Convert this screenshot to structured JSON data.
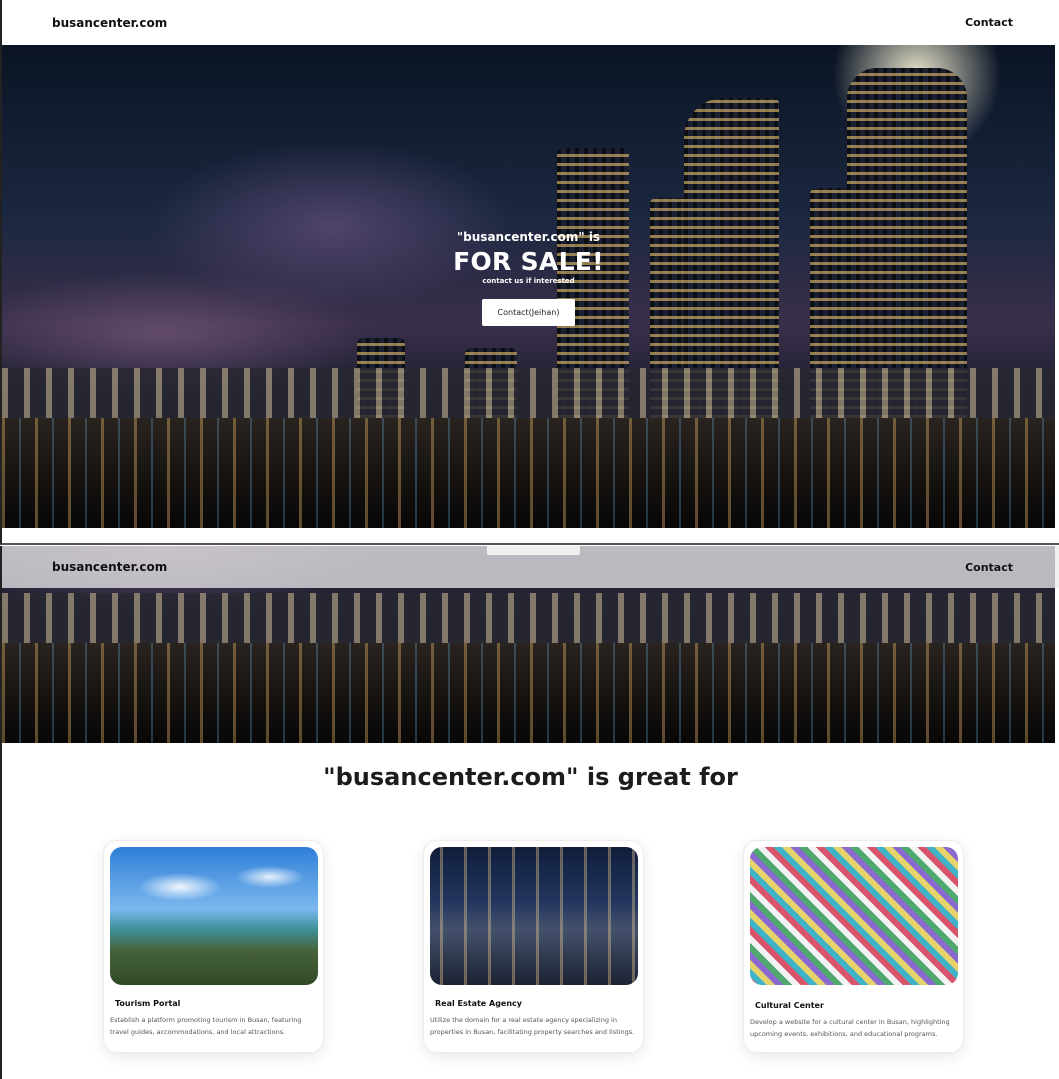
{
  "nav": {
    "brand": "busancenter.com",
    "contact_link": "Contact"
  },
  "hero": {
    "pre_title": "\"busancenter.com\" is",
    "title": "FOR SALE!",
    "subtitle": "contact us if interested",
    "button_label": "Contact(Jeihan)"
  },
  "section": {
    "title": "\"busancenter.com\" is great for"
  },
  "cards": [
    {
      "title": "Tourism Portal",
      "description": "Establish a platform promoting tourism in Busan, featuring travel guides, accommodations, and local attractions."
    },
    {
      "title": "Real Estate Agency",
      "description": "Utilize the domain for a real estate agency specializing in properties in Busan, facilitating property searches and listings."
    },
    {
      "title": "Cultural Center",
      "description": "Develop a website for a cultural center in Busan, highlighting upcoming events, exhibitions, and educational programs."
    }
  ]
}
